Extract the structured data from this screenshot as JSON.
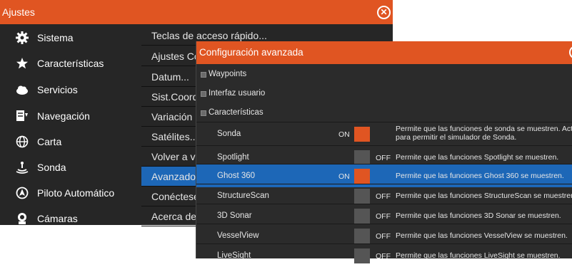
{
  "ajustes": {
    "title": "Ajustes",
    "close_icon": "close-circle-icon",
    "sidebar": [
      {
        "label": "Sistema",
        "icon": "gear-icon",
        "selected": true
      },
      {
        "label": "Características",
        "icon": "star-icon",
        "selected": false
      },
      {
        "label": "Servicios",
        "icon": "cloud-icon",
        "selected": false
      },
      {
        "label": "Navegación",
        "icon": "navigation-icon",
        "selected": false
      },
      {
        "label": "Carta",
        "icon": "globe-icon",
        "selected": false
      },
      {
        "label": "Sonda",
        "icon": "sonar-icon",
        "selected": false
      },
      {
        "label": "Piloto Automático",
        "icon": "autopilot-icon",
        "selected": false
      },
      {
        "label": "Cámaras",
        "icon": "camera-icon",
        "selected": false
      }
    ],
    "submenu": [
      {
        "label": "Teclas de acceso rápido...",
        "selected": false
      },
      {
        "label": "Ajustes Co",
        "selected": false
      },
      {
        "label": "Datum...",
        "selected": false
      },
      {
        "label": "Sist.Coorde",
        "selected": false
      },
      {
        "label": "Variación m",
        "selected": false
      },
      {
        "label": "Satélites...",
        "selected": false
      },
      {
        "label": "Volver a v",
        "selected": false
      },
      {
        "label": "Avanzado...",
        "selected": true
      },
      {
        "label": "Conéctese",
        "selected": false
      },
      {
        "label": "Acerca de",
        "selected": false
      }
    ]
  },
  "config": {
    "title": "Configuración avanzada",
    "tree": [
      {
        "label": "Waypoints"
      },
      {
        "label": "Interfaz usuario"
      },
      {
        "label": "Características"
      }
    ],
    "features": [
      {
        "name": "Sonda",
        "state": "on",
        "on_label": "ON",
        "off_label": "",
        "desc_line1": "Permite que las funciones de sonda se muestren. Activelo",
        "desc_line2": "para permitir el simulador de Sonda.",
        "selected": false
      },
      {
        "name": "Spotlight",
        "state": "off",
        "on_label": "",
        "off_label": "OFF",
        "desc_line1": "Permite que las funciones Spotlight se muestren.",
        "desc_line2": "",
        "selected": false
      },
      {
        "name": "Ghost 360",
        "state": "on",
        "on_label": "ON",
        "off_label": "",
        "desc_line1": "Permite que las funciones Ghost 360 se muestren.",
        "desc_line2": "",
        "selected": true
      },
      {
        "name": "StructureScan",
        "state": "off",
        "on_label": "",
        "off_label": "OFF",
        "desc_line1": "Permite que las funciones StructureScan se muestren.",
        "desc_line2": "",
        "selected": false
      },
      {
        "name": "3D Sonar",
        "state": "off",
        "on_label": "",
        "off_label": "OFF",
        "desc_line1": "Permite que las funciones 3D Sonar se muestren.",
        "desc_line2": "",
        "selected": false
      },
      {
        "name": "VesselView",
        "state": "off",
        "on_label": "",
        "off_label": "OFF",
        "desc_line1": "Permite que las funciones VesselView se muestren.",
        "desc_line2": "",
        "selected": false
      },
      {
        "name": "LiveSight",
        "state": "off",
        "on_label": "",
        "off_label": "OFF",
        "desc_line1": "Permite que las funciones LiveSight se muestren.",
        "desc_line2": "",
        "selected": false
      }
    ]
  },
  "colors": {
    "accent": "#e05522",
    "selection": "#1d67b7",
    "panel": "#262626",
    "toggle_off": "#555555"
  }
}
